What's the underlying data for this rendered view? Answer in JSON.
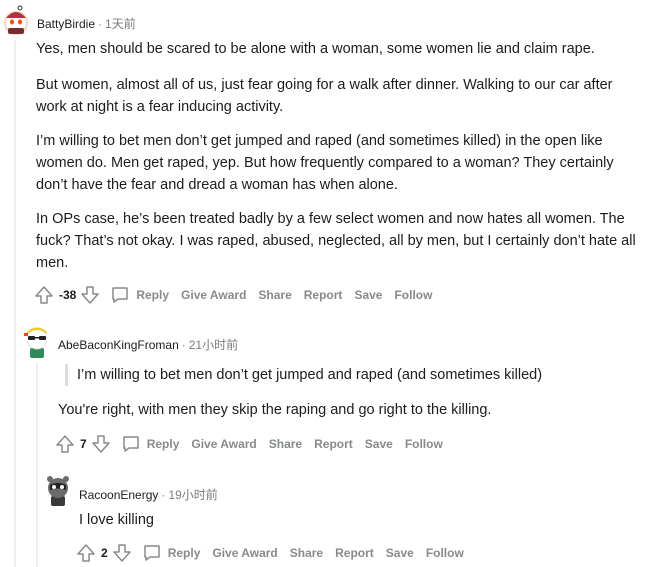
{
  "comments": [
    {
      "username": "BattyBirdie",
      "time": "1天前",
      "paragraphs": [
        "Yes, men should be scared to be alone with a woman, some women lie and claim rape.",
        "But women, almost all of us, just fear going for a walk after dinner. Walking to our car after work at night is a fear inducing activity.",
        "I’m willing to bet men don’t get jumped and raped (and sometimes killed) in the open like women do. Men get raped, yep. But how frequently compared to a woman? They certainly don’t have the fear and dread a woman has when alone.",
        "In OPs case, he’s been treated badly by a few select women and now hates all women. The fuck? That’s not okay. I was raped, abused, neglected, all by men, but I certainly don’t hate all men."
      ],
      "score": "-38"
    },
    {
      "username": "AbeBaconKingFroman",
      "time": "21小时前",
      "quote": "I’m willing to bet men don’t get jumped and raped (and sometimes killed)",
      "paragraphs": [
        "You're right, with men they skip the raping and go right to the killing."
      ],
      "score": "7"
    },
    {
      "username": "RacoonEnergy",
      "time": "19小时前",
      "paragraphs": [
        "I love killing"
      ],
      "score": "2"
    }
  ],
  "actions": {
    "reply": "Reply",
    "give_award": "Give Award",
    "share": "Share",
    "report": "Report",
    "save": "Save",
    "follow": "Follow"
  },
  "separator": "·",
  "colors": {
    "text": "#1c1c1c",
    "muted": "#7c7c7c",
    "action": "#878a8c",
    "thread": "#edeff1",
    "quote_bar": "#dcdcdc"
  },
  "icons": [
    "upvote-icon",
    "downvote-icon",
    "reply-bubble-icon"
  ]
}
